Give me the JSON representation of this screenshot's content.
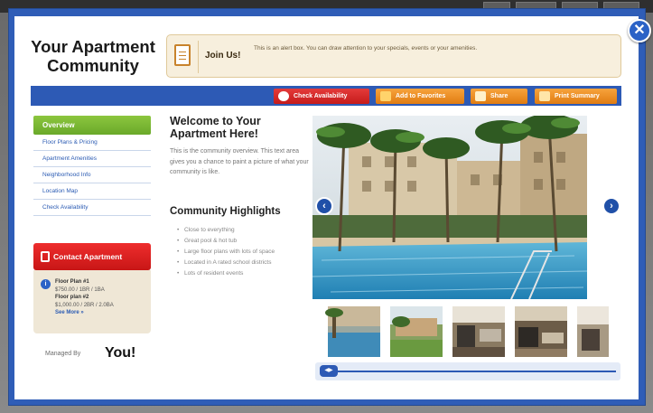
{
  "community": {
    "name": "Your Apartment Community"
  },
  "alert": {
    "join_label": "Join Us!",
    "text": "This is an alert box. You can draw attention to your specials, events or your amenities."
  },
  "toolbar": {
    "check_availability": "Check Availability",
    "add_to_favorites": "Add to Favorites",
    "share": "Share",
    "print_summary": "Print Summary"
  },
  "sidenav": {
    "active": "Overview",
    "items": [
      {
        "label": "Floor Plans & Pricing"
      },
      {
        "label": "Apartment Amenities"
      },
      {
        "label": "Neighborhood Info"
      },
      {
        "label": "Location Map"
      },
      {
        "label": "Check Availability"
      }
    ]
  },
  "contact": {
    "label": "Contact Apartment"
  },
  "floorplans": {
    "plan1_title": "Floor Plan #1",
    "plan1_detail": "$750.00 / 1BR / 1BA",
    "plan2_title": "Floor plan #2",
    "plan2_detail": "$1,000.00 / 2BR / 2.0BA",
    "see_more": "See More »"
  },
  "managed": {
    "label": "Managed By",
    "name": "You!"
  },
  "main": {
    "welcome": "Welcome to Your Apartment Here!",
    "overview": "This is the community overview. This text area gives you a chance to paint a picture of what your community is like.",
    "highlights_title": "Community Highlights",
    "highlights": [
      "Close to everything",
      "Great pool & hot tub",
      "Large floor plans with lots of space",
      "Located in A rated school districts",
      "Lots of resident events"
    ]
  },
  "gallery": {
    "prev_icon": "chevron-left-icon",
    "next_icon": "chevron-right-icon",
    "close_icon": "close-icon"
  },
  "colors": {
    "frame_blue": "#2f5db7",
    "toolbar_blue": "#2d5ab5",
    "nav_green": "#7ab833",
    "contact_red": "#d81e1e",
    "button_orange": "#ee8e22",
    "alert_bg": "#f7efdd"
  }
}
